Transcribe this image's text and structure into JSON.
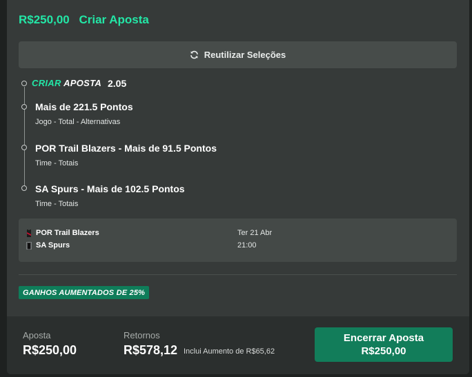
{
  "header": {
    "amount": "R$250,00",
    "title": "Criar Aposta"
  },
  "reuse_button": {
    "label": "Reutilizar Seleções",
    "icon": "refresh-icon"
  },
  "bet_builder": {
    "title_green": "CRIAR",
    "title_white": "APOSTA",
    "odds": "2.05"
  },
  "selections": [
    {
      "title": "Mais de 221.5 Pontos",
      "subtitle": "Jogo - Total - Alternativas"
    },
    {
      "title": "POR Trail Blazers - Mais de 91.5 Pontos",
      "subtitle": "Time - Totais"
    },
    {
      "title": "SA Spurs - Mais de 102.5 Pontos",
      "subtitle": "Time - Totais"
    }
  ],
  "match": {
    "home": "POR Trail Blazers",
    "away": "SA Spurs",
    "date": "Ter 21 Abr",
    "time": "21:00"
  },
  "boost_badge": "GANHOS AUMENTADOS DE 25%",
  "footer": {
    "stake_label": "Aposta",
    "stake_value": "R$250,00",
    "returns_label": "Retornos",
    "returns_value": "R$578,12",
    "boost_note": "Inclui Aumento de R$65,62",
    "cashout_line1": "Encerrar Aposta",
    "cashout_line2": "R$250,00"
  },
  "colors": {
    "accent": "#23e6a6",
    "button": "#127d5a",
    "card": "#363a39"
  }
}
